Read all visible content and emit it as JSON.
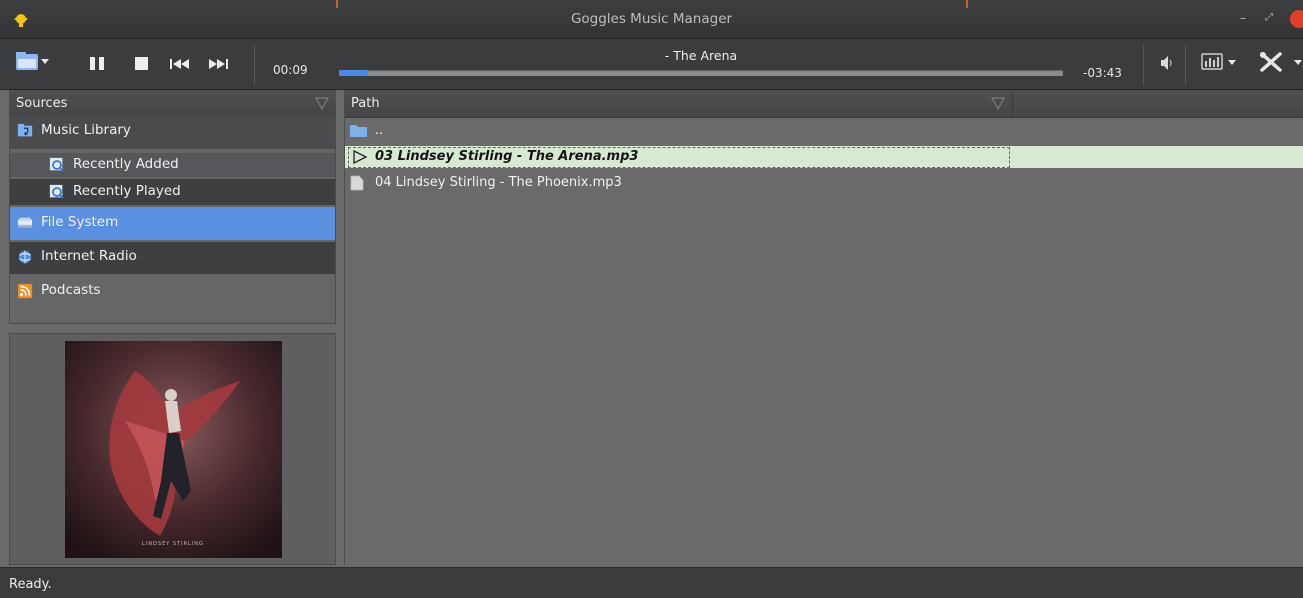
{
  "window": {
    "title": "Goggles Music Manager",
    "minimize_glyph": "–",
    "maximize_glyph": "⤢"
  },
  "toolbar": {
    "time_elapsed": "00:09",
    "time_remaining": "-03:43",
    "now_playing": " - The Arena",
    "progress_fraction": 0.04,
    "icons": [
      "open-menu-icon",
      "pause-icon",
      "stop-icon",
      "previous-track-icon",
      "next-track-icon",
      "volume-icon",
      "equalizer-icon",
      "preferences-icon"
    ]
  },
  "sources": {
    "header": "Sources",
    "items": [
      {
        "label": "Music Library",
        "icon": "music-library-icon",
        "indent": 0,
        "selected": false
      },
      {
        "label": "Recently Added",
        "icon": "recently-added-icon",
        "indent": 1,
        "selected": false
      },
      {
        "label": "Recently Played",
        "icon": "recently-played-icon",
        "indent": 1,
        "selected": false
      },
      {
        "label": "File System",
        "icon": "file-system-icon",
        "indent": 0,
        "selected": true
      },
      {
        "label": "Internet Radio",
        "icon": "internet-radio-icon",
        "indent": 0,
        "selected": false
      },
      {
        "label": "Podcasts",
        "icon": "podcasts-icon",
        "indent": 0,
        "selected": false
      }
    ]
  },
  "filelist": {
    "column_path": "Path",
    "parent_entry": "..",
    "files": [
      {
        "name": "03 Lindsey Stirling - The Arena.mp3",
        "playing": true
      },
      {
        "name": "04 Lindsey Stirling - The Phoenix.mp3",
        "playing": false
      }
    ]
  },
  "status": {
    "text": "Ready."
  },
  "colors": {
    "accent": "#4d89e8",
    "selection": "#5b8fe0",
    "playing_row": "#d9e8d3",
    "toolbar": "#3b3c3e",
    "close_button": "#e0402a"
  }
}
